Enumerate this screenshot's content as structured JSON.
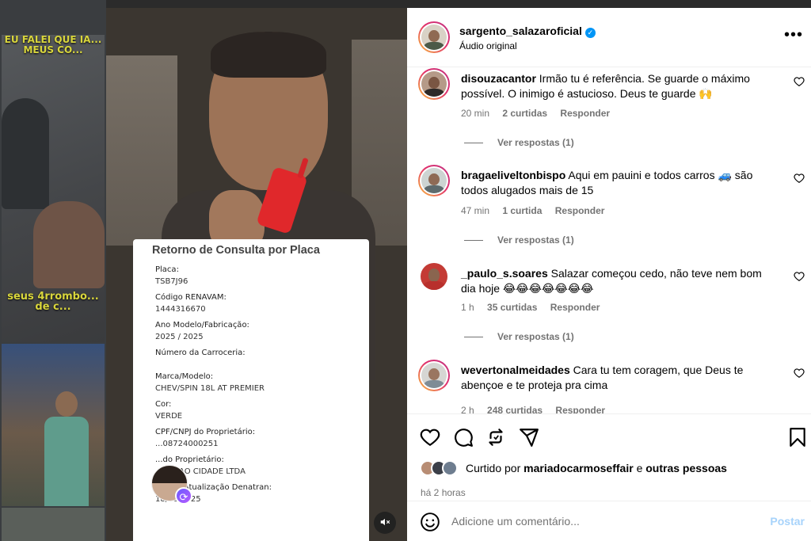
{
  "background_feed": {
    "caption_top": "EU FALEI QUE IA... MEUS CO...",
    "caption_bottom": "seus 4rrombo... de c..."
  },
  "video": {
    "document": {
      "title": "Retorno de Consulta por Placa",
      "fields": [
        {
          "label": "Placa:",
          "value": "TSB7J96"
        },
        {
          "label": "Código RENAVAM:",
          "value": "1444316670"
        },
        {
          "label": "Ano Modelo/Fabricação:",
          "value": "2025 / 2025"
        },
        {
          "label": "Número da Carroceria:",
          "value": ""
        },
        {
          "label": "Marca/Modelo:",
          "value": "CHEV/SPIN 18L AT PREMIER"
        },
        {
          "label": "Cor:",
          "value": "VERDE"
        },
        {
          "label": "CPF/CNPJ do Proprietário:",
          "value": "...08724000251"
        },
        {
          "label": "...do Proprietário:",
          "value": "...BACAO CIDADE LTDA"
        },
        {
          "label": "Última Atualização Denatran:",
          "value": "18/06/2025"
        }
      ]
    },
    "remix_icon": "remix-icon",
    "mute_icon": "muted-speaker-icon"
  },
  "post": {
    "username": "sargento_salazaroficial",
    "audio": "Áudio original",
    "more_options_icon": "more-options-icon"
  },
  "comments": [
    {
      "username": "disouzacantor",
      "text": "Irmão tu é referência. Se guarde o máximo possível. O inimigo é astucioso. Deus te guarde 🙌",
      "time": "20 min",
      "likes": "2 curtidas",
      "reply": "Responder",
      "view_replies": "Ver respostas (1)",
      "story_ring": true
    },
    {
      "username": "bragaeliveltonbispo",
      "text": "Aqui em pauini e todos carros 🚙 são todos alugados mais de 15",
      "time": "47 min",
      "likes": "1 curtida",
      "reply": "Responder",
      "view_replies": "Ver respostas (1)",
      "story_ring": true
    },
    {
      "username": "_paulo_s.soares",
      "text": "Salazar começou cedo, não teve nem bom dia hoje 😂😂😂😂😂😂😂",
      "time": "1 h",
      "likes": "35 curtidas",
      "reply": "Responder",
      "view_replies": "Ver respostas (1)",
      "story_ring": false
    },
    {
      "username": "wevertonalmeidades",
      "text": "Cara tu tem coragem, que Deus te abençoe e te proteja pra cima",
      "time": "2 h",
      "likes": "248 curtidas",
      "reply": "Responder",
      "view_replies": "",
      "story_ring": true
    }
  ],
  "actions": {
    "like_icon": "heart-icon",
    "comment_icon": "comment-icon",
    "share_icon": "repost-icon",
    "send_icon": "send-icon",
    "save_icon": "bookmark-icon",
    "liked_by_prefix": "Curtido por",
    "liked_by_user": "mariadocarmoseffair",
    "liked_by_and": "e",
    "liked_by_others": "outras pessoas",
    "post_age": "há 2 horas"
  },
  "comment_box": {
    "placeholder": "Adicione um comentário...",
    "post_label": "Postar",
    "emoji_icon": "emoji-icon"
  },
  "colors": {
    "accent": "#0095f6",
    "post_disabled": "#a7d3fb",
    "meta_text": "#737373"
  }
}
